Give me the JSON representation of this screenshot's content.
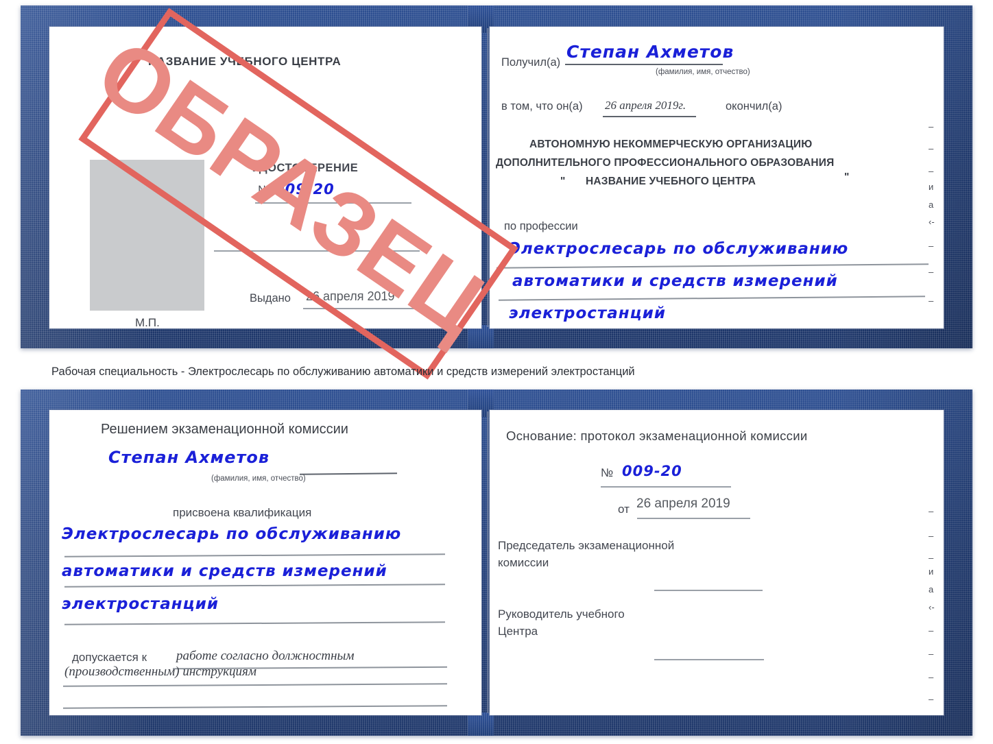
{
  "colors": {
    "cover_blue": "#24417c",
    "stamp_red": "#e2655e",
    "stamp_text_red": "#e98a83",
    "handwriting_blue": "#1a20d8",
    "photo_gray": "#c9cbcd",
    "rule_gray": "#9aa0a8"
  },
  "caption": "Рабочая специальность - Электрослесарь по обслуживанию автоматики и средств измерений электростанций",
  "stamp": {
    "text": "ОБРАЗЕЦ"
  },
  "certificate_top": {
    "left_page": {
      "center_name": "НАЗВАНИЕ УЧЕБНОГО ЦЕНТРА",
      "doc_title": "УДОСТОВЕРЕНИЕ",
      "number_symbol": "№",
      "number_value": "009-20",
      "issued_label": "Выдано",
      "issued_date": "26 апреля 2019",
      "seal_label": "М.П."
    },
    "right_page": {
      "received_label": "Получил(а)",
      "received_name": "Степан Ахметов",
      "name_caption": "(фамилия, имя, отчество)",
      "that_he_label": "в том, что он(а)",
      "completion_date": "26 апреля 2019г.",
      "finished_label": "окончил(а)",
      "org_line1": "АВТОНОМНУЮ НЕКОММЕРЧЕСКУЮ ОРГАНИЗАЦИЮ",
      "org_line2": "ДОПОЛНИТЕЛЬНОГО ПРОФЕССИОНАЛЬНОГО ОБРАЗОВАНИЯ",
      "org_quote_open": "\"",
      "org_line3": "НАЗВАНИЕ УЧЕБНОГО ЦЕНТРА",
      "org_quote_close": "\"",
      "profession_label": "по профессии",
      "profession_line1": "Электрослесарь по обслуживанию",
      "profession_line2": "автоматики и средств измерений",
      "profession_line3": "электростанций",
      "edge_fragments": [
        "–",
        "–",
        "–",
        "и",
        "а",
        "‹-",
        "–",
        "–",
        "–"
      ]
    }
  },
  "certificate_bottom": {
    "left_page": {
      "decision_title": "Решением экзаменационной комиссии",
      "name": "Степан Ахметов",
      "name_caption": "(фамилия, имя, отчество)",
      "qualification_label": "присвоена квалификация",
      "qualification_line1": "Электрослесарь по обслуживанию",
      "qualification_line2": "автоматики и средств измерений",
      "qualification_line3": "электростанций",
      "allowed_label": "допускается к",
      "allowed_line1": "работе согласно должностным",
      "allowed_line2": "(производственным) инструкциям"
    },
    "right_page": {
      "basis_label": "Основание: протокол экзаменационной комиссии",
      "number_symbol": "№",
      "number_value": "009-20",
      "from_label": "от",
      "from_date": "26 апреля 2019",
      "chairman_line1": "Председатель экзаменационной",
      "chairman_line2": "комиссии",
      "head_line1": "Руководитель учебного",
      "head_line2": "Центра",
      "edge_fragments": [
        "–",
        "–",
        "–",
        "и",
        "а",
        "‹-",
        "–",
        "–",
        "–",
        "–"
      ]
    }
  }
}
